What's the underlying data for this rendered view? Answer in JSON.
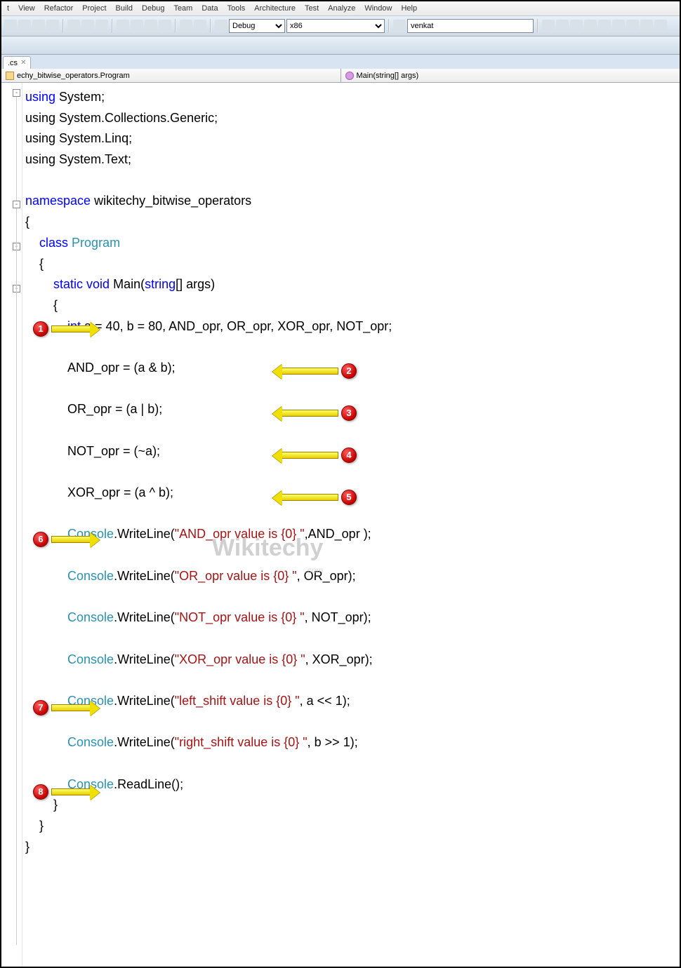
{
  "menu": {
    "items": [
      "t",
      "View",
      "Refactor",
      "Project",
      "Build",
      "Debug",
      "Team",
      "Data",
      "Tools",
      "Architecture",
      "Test",
      "Analyze",
      "Window",
      "Help"
    ]
  },
  "toolbar": {
    "config": "Debug",
    "platform": "x86",
    "search": "venkat"
  },
  "tab": {
    "name": ".cs"
  },
  "nav": {
    "left": "echy_bitwise_operators.Program",
    "right": "Main(string[] args)"
  },
  "code": {
    "u1": "using",
    "s1": "System",
    "l2": "using System.Collections.Generic;",
    "l3": "using System.Linq;",
    "l4": "using System.Text;",
    "ns": "namespace",
    "nsname": "wikitechy_bitwise_operators",
    "cls": "class",
    "clsname": "Program",
    "st": "static",
    "vd": "void",
    "mn": "Main(",
    "strt": "string",
    "mnargs": "[] args)",
    "intkw": "int",
    "decl": " a = 40, b = 80, AND_opr, OR_opr, XOR_opr, NOT_opr;",
    "and": "AND_opr = (a & b);",
    "or": "OR_opr = (a | b);",
    "not": "NOT_opr = (~a);",
    "xor": "XOR_opr = (a ^ b);",
    "con": "Console",
    "wl": ".WriteLine(",
    "rl": ".ReadLine();",
    "s_and": "\"AND_opr value is {0} \"",
    "a_and": ",AND_opr );",
    "s_or": "\"OR_opr value is {0} \"",
    "a_or": ", OR_opr);",
    "s_not": "\"NOT_opr value is {0} \"",
    "a_not": ", NOT_opr);",
    "s_xor": "\"XOR_opr value is {0} \"",
    "a_xor": ", XOR_opr);",
    "s_ls": "\"left_shift value is {0} \"",
    "a_ls": ", a << 1);",
    "s_rs": "\"right_shift value is {0} \"",
    "a_rs": ", b >> 1);"
  },
  "watermark": "Wikitechy",
  "badges": {
    "1": "1",
    "2": "2",
    "3": "3",
    "4": "4",
    "5": "5",
    "6": "6",
    "7": "7",
    "8": "8"
  }
}
